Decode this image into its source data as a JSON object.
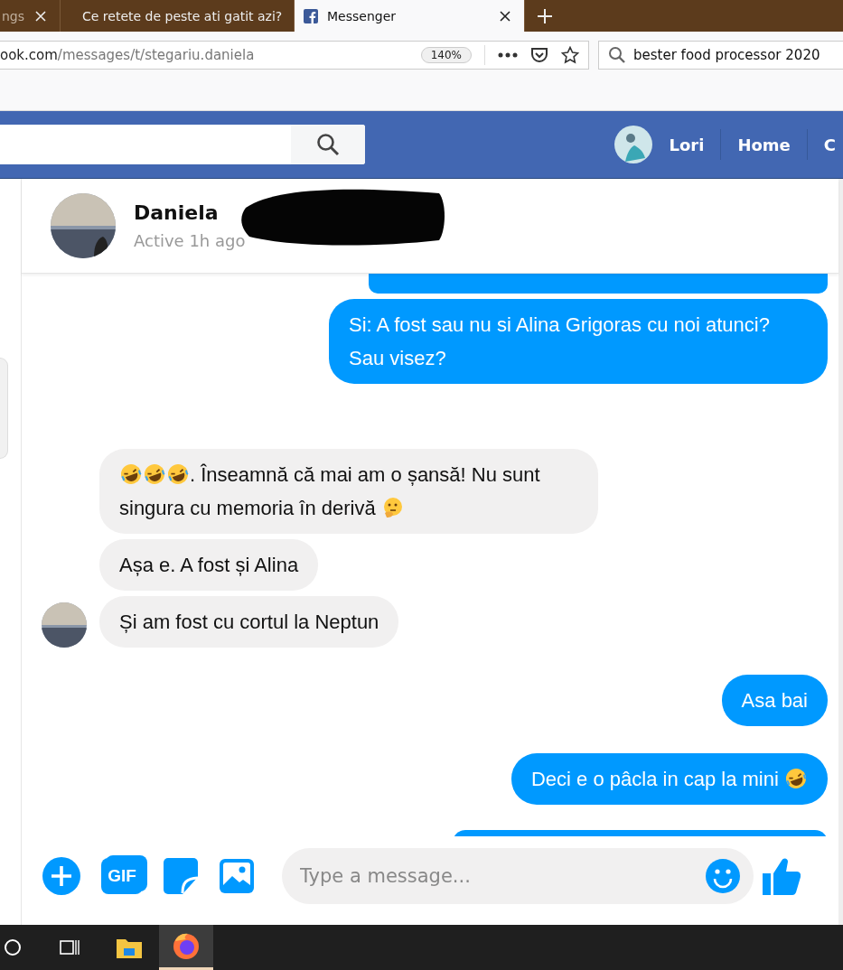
{
  "browser": {
    "tabs": [
      {
        "title": "ngs",
        "selected": false
      },
      {
        "title": "Ce retete de peste ati gatit azi?",
        "selected": false
      },
      {
        "title": "Messenger",
        "selected": true
      }
    ],
    "url": {
      "host": "ook.com",
      "path": "/messages/t/stegariu.daniela"
    },
    "zoom": "140%",
    "search": "bester food processor 2020"
  },
  "topbar": {
    "user": "Lori",
    "links": [
      "Home",
      "C"
    ]
  },
  "contact": {
    "name": "Daniela",
    "status": "Active 1h ago",
    "redacted": true
  },
  "messages": [
    {
      "kind": "sent",
      "clipped": true
    },
    {
      "kind": "sent",
      "parts": [
        {
          "kind": "text",
          "text": "Si: A fost sau nu si Alina Grigoras cu noi atunci? Sau visez?"
        }
      ]
    },
    {
      "kind": "received",
      "avatar": false,
      "parts": [
        {
          "kind": "laugh-emoji"
        },
        {
          "kind": "laugh-emoji"
        },
        {
          "kind": "laugh-emoji"
        },
        {
          "kind": "text",
          "text": ". Înseamnă că mai am o șansă! Nu sunt singura cu memoria în derivă "
        },
        {
          "kind": "think-emoji"
        }
      ]
    },
    {
      "kind": "received",
      "avatar": false,
      "parts": [
        {
          "kind": "text",
          "text": "Așa e. A fost și Alina"
        }
      ]
    },
    {
      "kind": "received",
      "avatar": true,
      "parts": [
        {
          "kind": "text",
          "text": "Și am fost cu cortul la Neptun"
        }
      ]
    },
    {
      "kind": "sent",
      "parts": [
        {
          "kind": "text",
          "text": "Asa bai"
        }
      ]
    },
    {
      "kind": "sent",
      "parts": [
        {
          "kind": "text",
          "text": "Deci e o pâcla in cap la mini "
        },
        {
          "kind": "laugh-emoji"
        }
      ]
    },
    {
      "kind": "sent",
      "clipped": true
    }
  ],
  "composer": {
    "gif_label": "GIF",
    "placeholder": "Type a message..."
  }
}
